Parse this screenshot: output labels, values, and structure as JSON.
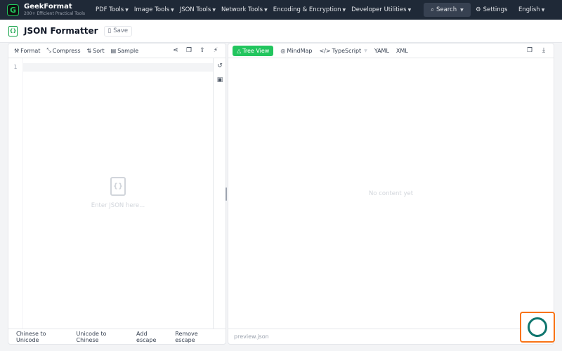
{
  "brand": {
    "name": "GeekFormat",
    "tagline": "200+ Efficient Practical Tools",
    "logo_letter": "G"
  },
  "nav": [
    {
      "label": "PDF Tools"
    },
    {
      "label": "Image Tools"
    },
    {
      "label": "JSON Tools"
    },
    {
      "label": "Network Tools"
    },
    {
      "label": "Encoding & Encryption"
    },
    {
      "label": "Developer Utilities"
    }
  ],
  "header": {
    "search_label": "Search",
    "settings_label": "Settings",
    "language_label": "English"
  },
  "page": {
    "title": "JSON Formatter",
    "save_label": "Save"
  },
  "editor": {
    "toolbar": {
      "format": "Format",
      "compress": "Compress",
      "sort": "Sort",
      "sample": "Sample"
    },
    "line_number": "1",
    "placeholder": "Enter JSON here...",
    "footer": {
      "chinese_to_unicode": "Chinese to Unicode",
      "unicode_to_chinese": "Unicode to Chinese",
      "add_escape": "Add escape",
      "remove_escape": "Remove escape"
    }
  },
  "preview": {
    "tabs": {
      "tree_view": "Tree View",
      "mindmap": "MindMap",
      "typescript": "TypeScript",
      "yaml": "YAML",
      "xml": "XML"
    },
    "empty_text": "No content yet",
    "filename": "preview.json"
  },
  "colors": {
    "accent": "#22c55e",
    "topbar": "#1f2937"
  }
}
